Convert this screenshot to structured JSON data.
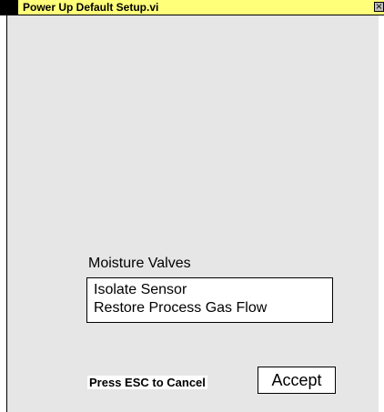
{
  "window": {
    "title": "Power Up Default Setup.vi",
    "titlebar_color": "#ffff7a",
    "close_icon": "close-icon"
  },
  "moisture_valves": {
    "label": "Moisture Valves",
    "items": [
      "Isolate Sensor",
      "Restore Process Gas Flow"
    ]
  },
  "footer": {
    "esc_hint": "Press ESC to Cancel",
    "accept_label": "Accept"
  }
}
